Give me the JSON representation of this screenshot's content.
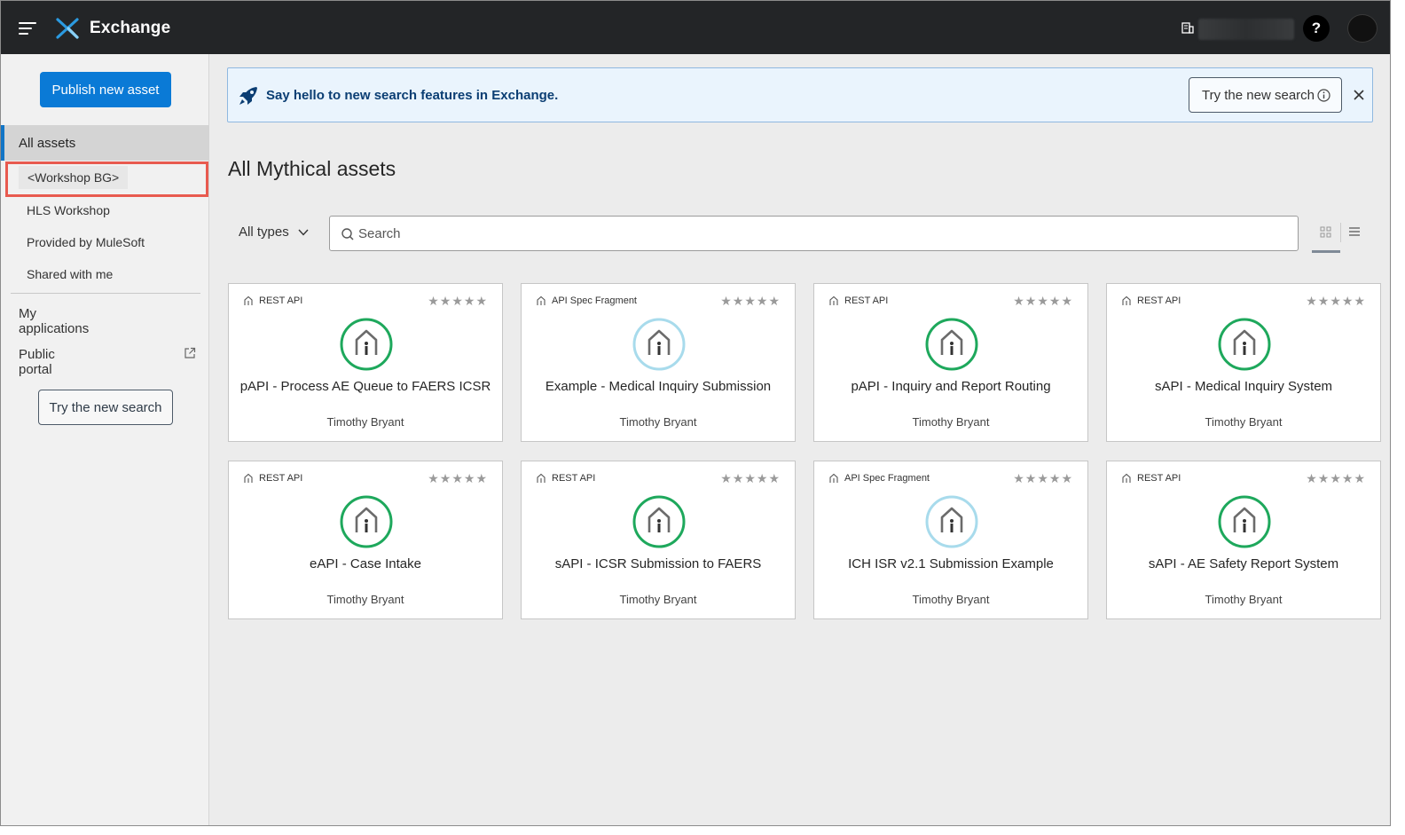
{
  "header": {
    "app_title": "Exchange",
    "help_label": "?"
  },
  "sidebar": {
    "publish_label": "Publish new asset",
    "all_assets": "All assets",
    "items": [
      "<Workshop BG>",
      "HLS Workshop",
      "Provided by MuleSoft",
      "Shared with me"
    ],
    "my_applications": "My applications",
    "public_portal": "Public portal",
    "try_new_search": "Try the new search"
  },
  "banner": {
    "message": "Say hello to new search features in Exchange.",
    "try_label": "Try the new search"
  },
  "main": {
    "title": "All Mythical assets",
    "types_filter": "All types",
    "search_placeholder": "Search"
  },
  "cards": [
    {
      "type": "REST API",
      "name": "pAPI - Process AE Queue to FAERS ICSR",
      "author": "Timothy Bryant",
      "rating": 0,
      "icon_color": "#1ea85c"
    },
    {
      "type": "API Spec Fragment",
      "name": "Example - Medical Inquiry Submission",
      "author": "Timothy Bryant",
      "rating": 0,
      "icon_color": "#a8dbec"
    },
    {
      "type": "REST API",
      "name": "pAPI - Inquiry and Report Routing",
      "author": "Timothy Bryant",
      "rating": 0,
      "icon_color": "#1ea85c"
    },
    {
      "type": "REST API",
      "name": "sAPI - Medical Inquiry System",
      "author": "Timothy Bryant",
      "rating": 0,
      "icon_color": "#1ea85c"
    },
    {
      "type": "REST API",
      "name": "eAPI - Case Intake",
      "author": "Timothy Bryant",
      "rating": 0,
      "icon_color": "#1ea85c"
    },
    {
      "type": "REST API",
      "name": "sAPI - ICSR Submission to FAERS",
      "author": "Timothy Bryant",
      "rating": 0,
      "icon_color": "#1ea85c"
    },
    {
      "type": "API Spec Fragment",
      "name": "ICH ISR v2.1 Submission Example",
      "author": "Timothy Bryant",
      "rating": 0,
      "icon_color": "#a8dbec"
    },
    {
      "type": "REST API",
      "name": "sAPI - AE Safety Report System",
      "author": "Timothy Bryant",
      "rating": 0,
      "icon_color": "#1ea85c"
    }
  ],
  "colors": {
    "primary": "#0a7ad6",
    "topbar": "#232527",
    "highlight_box": "#e85a4f"
  },
  "icons": [
    "hamburger-icon",
    "exchange-logo-icon",
    "org-icon",
    "help-icon",
    "rocket-icon",
    "info-icon",
    "close-icon",
    "chevron-down-icon",
    "search-icon",
    "grid-view-icon",
    "list-view-icon",
    "external-link-icon",
    "asset-icon",
    "asset-type-icon",
    "star-icon"
  ]
}
